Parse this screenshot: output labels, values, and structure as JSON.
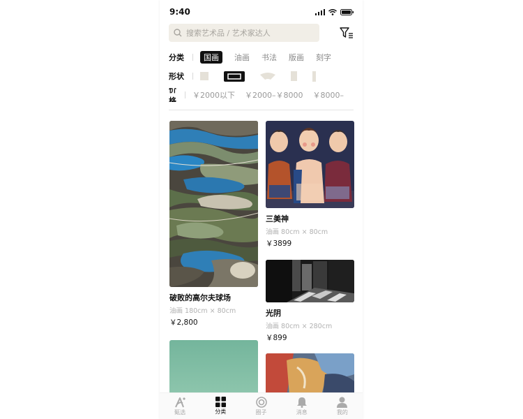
{
  "status": {
    "time": "9:40"
  },
  "search": {
    "placeholder": "搜索艺术品 / 艺术家达人"
  },
  "filters": {
    "category": {
      "label": "分类",
      "options": [
        "国画",
        "油画",
        "书法",
        "版画",
        "刻字"
      ],
      "selected": "国画"
    },
    "shape": {
      "label": "形状",
      "options": [
        "square-icon",
        "landscape-icon",
        "fan-icon",
        "portrait-icon",
        "vertical-strip-icon"
      ],
      "selected": "landscape-icon"
    },
    "price": {
      "label": "价格",
      "options": [
        "￥2000以下",
        "￥2000–￥8000",
        "￥8000–"
      ]
    }
  },
  "artworks": [
    {
      "title": "破败的高尔夫球场",
      "meta": "油画 180cm × 80cm",
      "price": "￥2,800"
    },
    {
      "title": "三美神",
      "meta": "油画 80cm × 80cm",
      "price": "￥3899"
    },
    {
      "title": "光阴",
      "meta": "油画 80cm × 280cm",
      "price": "￥899"
    }
  ],
  "tabbar": {
    "items": [
      {
        "label": "甄选",
        "icon": "pen-logo-icon"
      },
      {
        "label": "分类",
        "icon": "category-grid-icon"
      },
      {
        "label": "圈子",
        "icon": "circle-target-icon"
      },
      {
        "label": "消息",
        "icon": "bell-icon"
      },
      {
        "label": "我的",
        "icon": "person-icon"
      }
    ],
    "active": "分类"
  },
  "colors": {
    "search_bg": "#f1eee7",
    "accent": "#111111",
    "muted": "#999999"
  }
}
